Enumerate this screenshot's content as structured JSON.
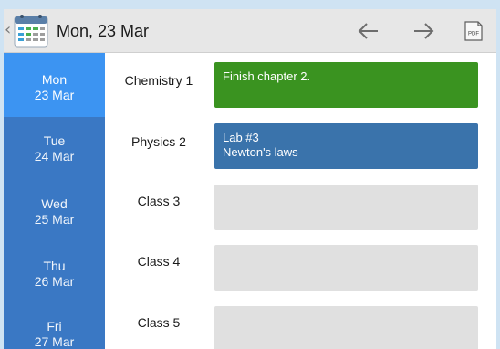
{
  "header": {
    "title": "Mon, 23 Mar",
    "icons": [
      "back-chevron-icon",
      "calendar-app-icon",
      "arrow-left-icon",
      "arrow-right-icon",
      "pdf-icon"
    ],
    "pdf_label": "PDF"
  },
  "days": [
    {
      "name": "Mon",
      "date": "23 Mar",
      "selected": true
    },
    {
      "name": "Tue",
      "date": "24 Mar",
      "selected": false
    },
    {
      "name": "Wed",
      "date": "25 Mar",
      "selected": false
    },
    {
      "name": "Thu",
      "date": "26 Mar",
      "selected": false
    },
    {
      "name": "Fri",
      "date": "27 Mar",
      "selected": false
    }
  ],
  "classes": [
    {
      "label": "Chemistry 1",
      "note_lines": [
        "Finish chapter 2."
      ],
      "color": "#3a9320"
    },
    {
      "label": "Physics 2",
      "note_lines": [
        "Lab #3",
        "Newton's laws"
      ],
      "color": "#3a73ab"
    },
    {
      "label": "Class 3",
      "note_lines": [],
      "color": "#e0e0e0"
    },
    {
      "label": "Class 4",
      "note_lines": [],
      "color": "#e0e0e0"
    },
    {
      "label": "Class 5",
      "note_lines": [],
      "color": "#e0e0e0"
    }
  ],
  "colors": {
    "background": "#cfe3f3",
    "sidebar": "#3a78c4",
    "sidebar_selected": "#3c94f2",
    "header": "#e7e7e7"
  }
}
